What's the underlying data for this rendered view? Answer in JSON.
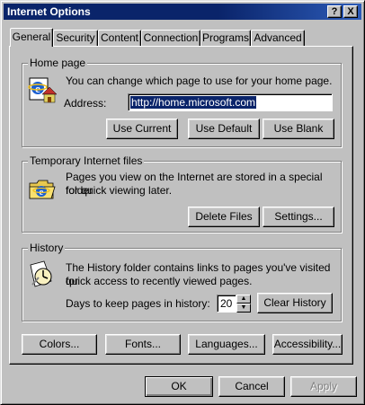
{
  "window": {
    "title": "Internet Options",
    "help_button": "?",
    "close_button": "X"
  },
  "tabs": [
    "General",
    "Security",
    "Content",
    "Connection",
    "Programs",
    "Advanced"
  ],
  "home_page": {
    "legend": "Home page",
    "description": "You can change which page to use for your home page.",
    "address_label": "Address:",
    "address_value": "http://home.microsoft.com",
    "use_current": "Use Current",
    "use_default": "Use Default",
    "use_blank": "Use Blank"
  },
  "temp_files": {
    "legend": "Temporary Internet files",
    "description_line1": "Pages you view on the Internet are stored in a special folder",
    "description_line2": "for quick viewing later.",
    "delete_files": "Delete Files",
    "settings": "Settings..."
  },
  "history": {
    "legend": "History",
    "description_line1": "The History folder contains links to pages you've visited for",
    "description_line2": "quick access to recently viewed pages.",
    "days_label": "Days to keep pages in history:",
    "days_value": "20",
    "clear_history": "Clear History"
  },
  "bottom_buttons": {
    "colors": "Colors...",
    "fonts": "Fonts...",
    "languages": "Languages...",
    "accessibility": "Accessibility..."
  },
  "dialog_buttons": {
    "ok": "OK",
    "cancel": "Cancel",
    "apply": "Apply"
  },
  "icons": {
    "home": "ie-home-icon",
    "temp": "ie-folder-icon",
    "history": "history-clock-icon"
  }
}
